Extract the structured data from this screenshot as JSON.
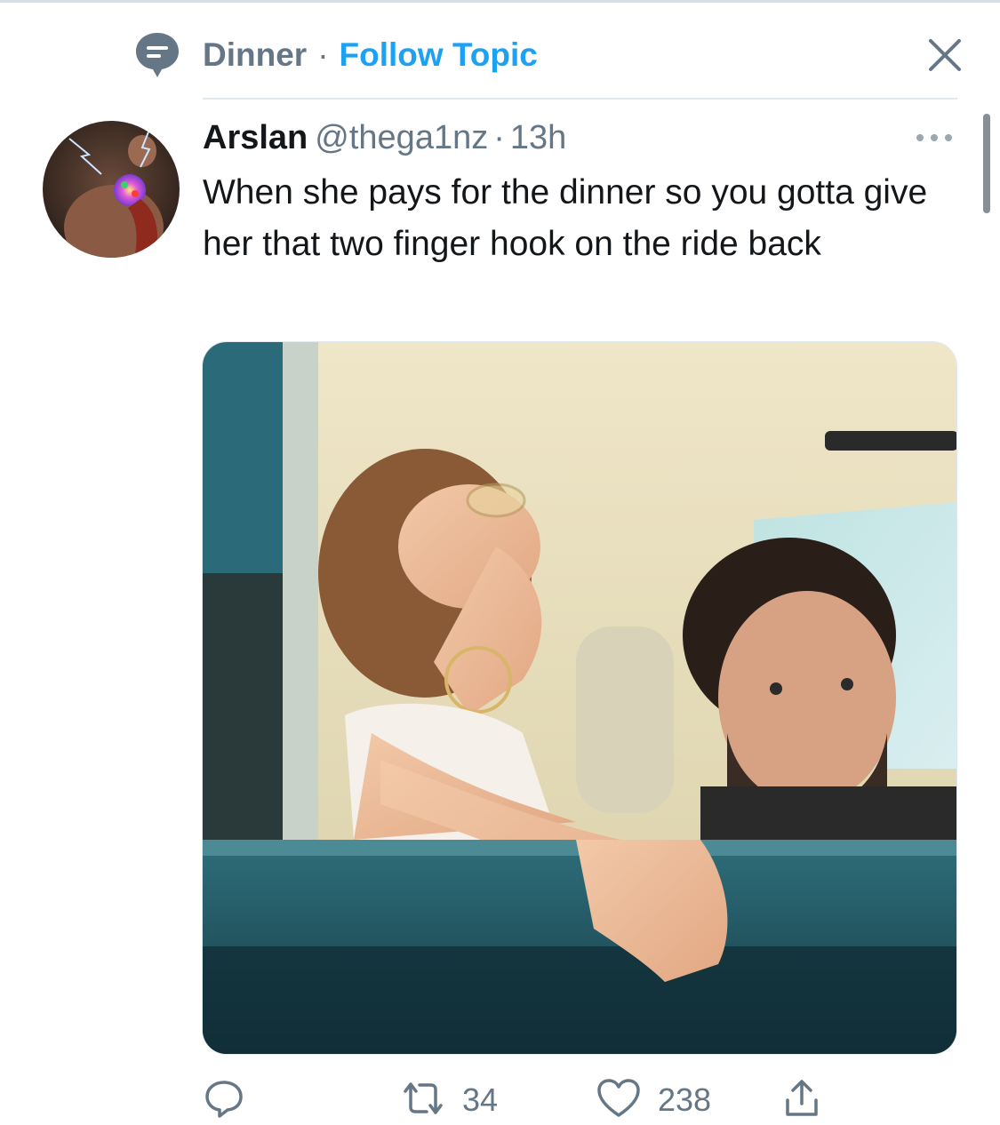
{
  "topic": {
    "name": "Dinner",
    "separator": "·",
    "follow_label": "Follow Topic",
    "icon": "topic-speech-bubble-icon",
    "close_icon": "close-icon"
  },
  "tweet": {
    "display_name": "Arslan",
    "handle": "@thega1nz",
    "separator": "·",
    "timestamp": "13h",
    "text": "When she pays for the dinner so you gotta give her that two finger hook on the ride back",
    "more_icon": "more-dots-icon",
    "avatar_icon": "avatar",
    "media": "photo"
  },
  "actions": {
    "reply": {
      "icon": "reply-icon",
      "count": ""
    },
    "retweet": {
      "icon": "retweet-icon",
      "count": "34"
    },
    "like": {
      "icon": "heart-icon",
      "count": "238"
    },
    "share": {
      "icon": "share-icon"
    }
  },
  "colors": {
    "accent": "#1da1f2",
    "muted": "#657786",
    "text": "#14171a",
    "divider": "#e1e8ed"
  }
}
